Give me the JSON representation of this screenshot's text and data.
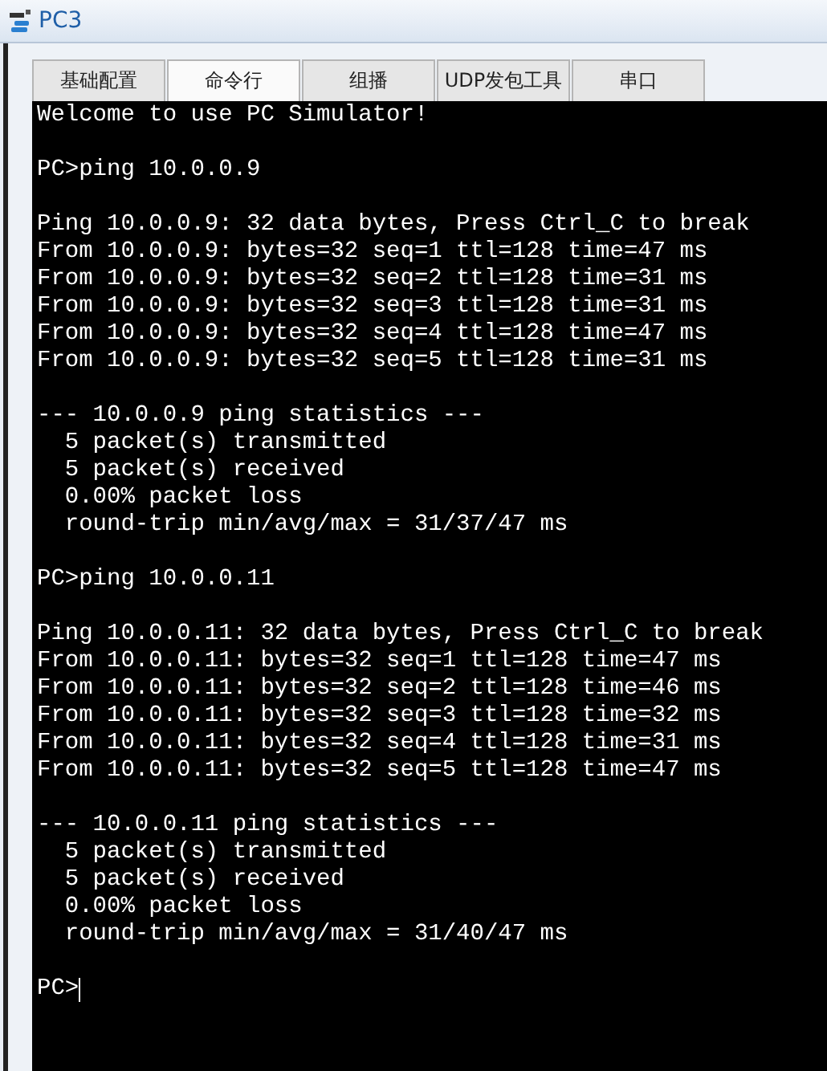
{
  "window": {
    "title": "PC3"
  },
  "tabs": [
    {
      "label": "基础配置",
      "selected": false
    },
    {
      "label": "命令行",
      "selected": true
    },
    {
      "label": "组播",
      "selected": false
    },
    {
      "label": "UDP发包工具",
      "selected": false
    },
    {
      "label": "串口",
      "selected": false
    }
  ],
  "terminal": {
    "blocks": [
      [
        "Welcome to use PC Simulator!"
      ],
      [
        "PC>ping 10.0.0.9"
      ],
      [
        "Ping 10.0.0.9: 32 data bytes, Press Ctrl_C to break",
        "From 10.0.0.9: bytes=32 seq=1 ttl=128 time=47 ms",
        "From 10.0.0.9: bytes=32 seq=2 ttl=128 time=31 ms",
        "From 10.0.0.9: bytes=32 seq=3 ttl=128 time=31 ms",
        "From 10.0.0.9: bytes=32 seq=4 ttl=128 time=47 ms",
        "From 10.0.0.9: bytes=32 seq=5 ttl=128 time=31 ms"
      ],
      [
        "--- 10.0.0.9 ping statistics ---",
        "  5 packet(s) transmitted",
        "  5 packet(s) received",
        "  0.00% packet loss",
        "  round-trip min/avg/max = 31/37/47 ms"
      ],
      [
        "PC>ping 10.0.0.11"
      ],
      [
        "Ping 10.0.0.11: 32 data bytes, Press Ctrl_C to break",
        "From 10.0.0.11: bytes=32 seq=1 ttl=128 time=47 ms",
        "From 10.0.0.11: bytes=32 seq=2 ttl=128 time=46 ms",
        "From 10.0.0.11: bytes=32 seq=3 ttl=128 time=32 ms",
        "From 10.0.0.11: bytes=32 seq=4 ttl=128 time=31 ms",
        "From 10.0.0.11: bytes=32 seq=5 ttl=128 time=47 ms"
      ],
      [
        "--- 10.0.0.11 ping statistics ---",
        "  5 packet(s) transmitted",
        "  5 packet(s) received",
        "  0.00% packet loss",
        "  round-trip min/avg/max = 31/40/47 ms"
      ]
    ],
    "prompt": "PC>"
  }
}
